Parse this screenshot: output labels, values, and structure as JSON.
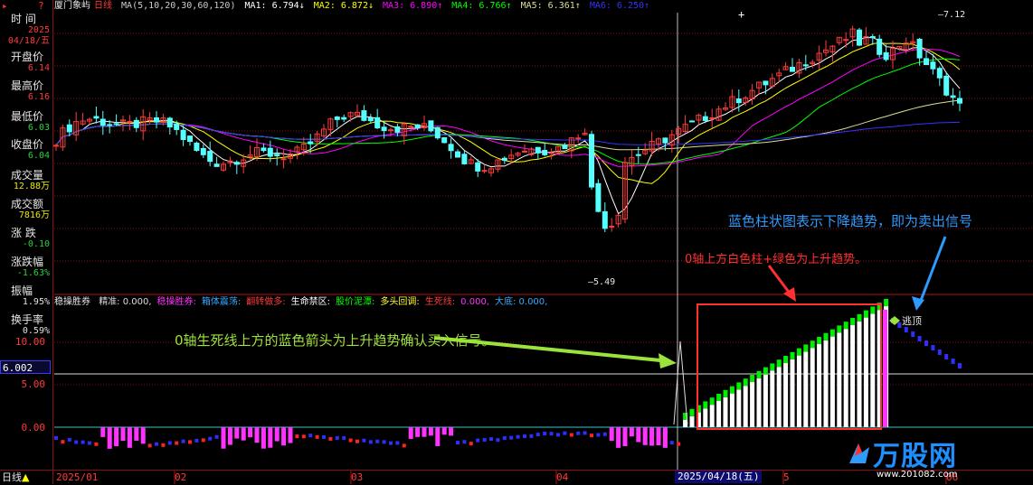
{
  "sidebar": {
    "title_label": "时 间",
    "date_year": "2025",
    "date_day": "04/18/五",
    "rows": [
      {
        "label": "开盘价",
        "value": "6.14",
        "color": "red"
      },
      {
        "label": "最高价",
        "value": "6.16",
        "color": "red"
      },
      {
        "label": "最低价",
        "value": "6.03",
        "color": "green"
      },
      {
        "label": "收盘价",
        "value": "6.04",
        "color": "green"
      },
      {
        "label": "成交量",
        "value": "12.88万",
        "color": "yellow"
      },
      {
        "label": "成交额",
        "value": "7816万",
        "color": "yellow"
      },
      {
        "label": "涨 跌",
        "value": "-0.10",
        "color": "green"
      },
      {
        "label": "涨跌幅",
        "value": "-1.63%",
        "color": "green"
      },
      {
        "label": "振幅",
        "value": "1.95%",
        "color": "white"
      },
      {
        "label": "换手率",
        "value": "0.59%",
        "color": "white"
      }
    ]
  },
  "header": {
    "stock_name": "厦门象屿",
    "period": "日线",
    "ma_def": "MA(5,10,20,30,60,120)",
    "ma1": "MA1: 6.794↓",
    "ma2": "MA2: 6.872↓",
    "ma3": "MA3: 6.890↑",
    "ma4": "MA4: 6.766↑",
    "ma5": "MA5: 6.361↑",
    "ma6": "MA6: 6.250↑"
  },
  "colors": {
    "ma1": "#ffffff",
    "ma2": "#ffff00",
    "ma3": "#ff00ff",
    "ma4": "#00ff00",
    "ma5": "#dddd99",
    "ma6": "#3333ff",
    "up": "#ff3b3b",
    "down": "#55ffff",
    "grid": "#8a1010"
  },
  "price_labels": {
    "high": "7.12",
    "low": "5.49"
  },
  "indicator": {
    "name": "稳操胜券",
    "items": [
      {
        "text": "精准: 0.000,",
        "color": "#dddddd"
      },
      {
        "text": "稳操胜券:",
        "color": "#ff33ff"
      },
      {
        "text": "箱体震荡:",
        "color": "#33aaff"
      },
      {
        "text": "翻转做多:",
        "color": "#ff3b3b"
      },
      {
        "text": "生命禁区:",
        "color": "#ffffff"
      },
      {
        "text": "股价泥潭:",
        "color": "#00ff00"
      },
      {
        "text": "多头回调:",
        "color": "#ffff33"
      },
      {
        "text": "生死线:",
        "color": "#ff3b3b"
      },
      {
        "text": "0.000,",
        "color": "#ff33ff"
      },
      {
        "text": "大底: 0.000,",
        "color": "#33aaff"
      }
    ],
    "axis": {
      "top": "10.00",
      "current": "6.002",
      "mid": "5.00",
      "zero": "0.00"
    },
    "escape_label": "逃顶"
  },
  "annotations": {
    "sell": "蓝色柱状图表示下降趋势，即为卖出信号",
    "up_trend": "0轴上方白色柱+绿色为上升趋势。",
    "buy": "0轴生死线上方的蓝色箭头为上升趋势确认买入信号。"
  },
  "bottom": {
    "period_label": "日线",
    "ticks": [
      {
        "text": "2025/01"
      },
      {
        "text": "02"
      },
      {
        "text": "03"
      },
      {
        "text": "04"
      },
      {
        "text": "5"
      },
      {
        "text": "06"
      }
    ],
    "cursor_date": "2025/04/18(五)"
  },
  "logo": {
    "name": "万股网",
    "url": "www.201082.com"
  }
}
